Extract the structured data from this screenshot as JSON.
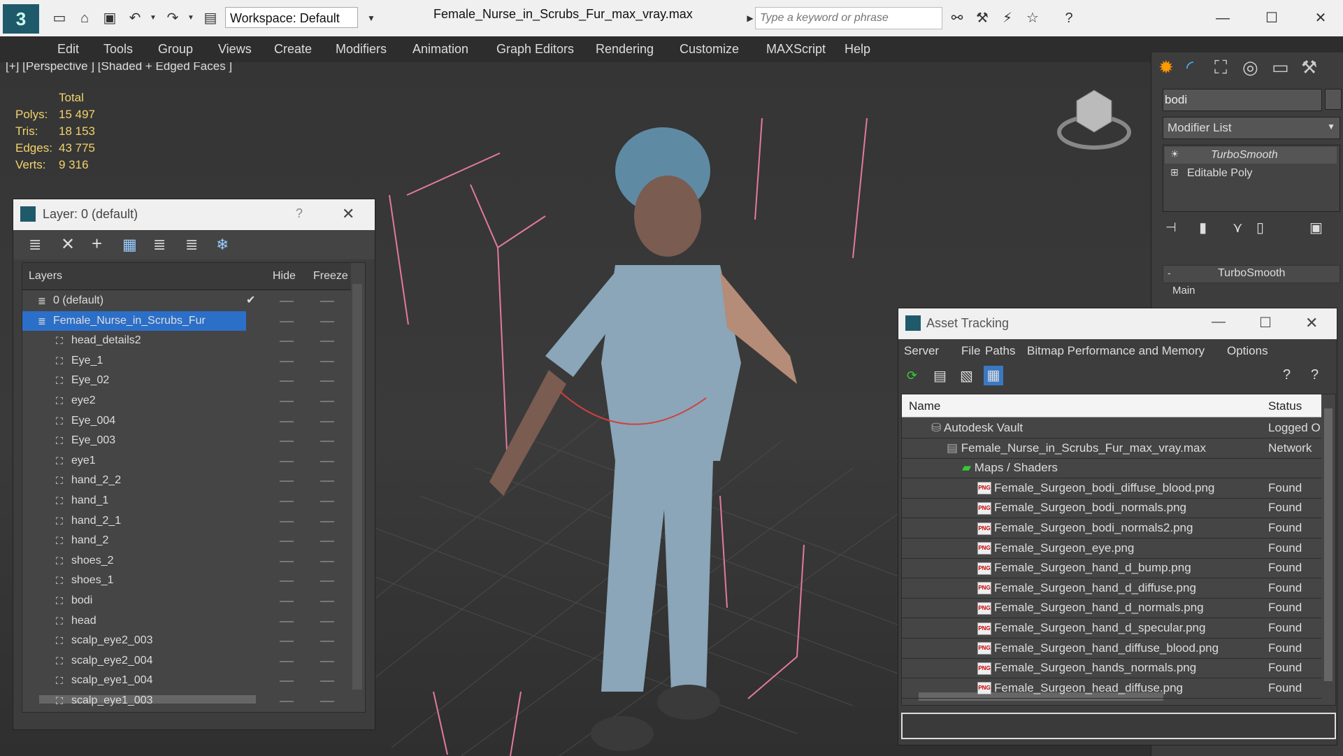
{
  "window": {
    "file_title": "Female_Nurse_in_Scrubs_Fur_max_vray.max",
    "workspace_label": "Workspace: Default",
    "search_placeholder": "Type a keyword or phrase"
  },
  "menu": [
    "Edit",
    "Tools",
    "Group",
    "Views",
    "Create",
    "Modifiers",
    "Animation",
    "Graph Editors",
    "Rendering",
    "Customize",
    "MAXScript",
    "Help"
  ],
  "viewport": {
    "label": "[+] [Perspective ] [Shaded + Edged Faces ]",
    "stats_header": "Total",
    "stats": [
      {
        "label": "Polys:",
        "value": "15 497"
      },
      {
        "label": "Tris:",
        "value": "18 153"
      },
      {
        "label": "Edges:",
        "value": "43 775"
      },
      {
        "label": "Verts:",
        "value": "9 316"
      }
    ]
  },
  "layer_panel": {
    "title": "Layer: 0 (default)",
    "help": "?",
    "col_layers": "Layers",
    "col_hide": "Hide",
    "col_freeze": "Freeze",
    "rows": [
      {
        "name": "0 (default)",
        "level": 1,
        "checked": true
      },
      {
        "name": "Female_Nurse_in_Scrubs_Fur",
        "level": 1,
        "selected": true
      },
      {
        "name": "head_details2",
        "level": 2
      },
      {
        "name": "Eye_1",
        "level": 2
      },
      {
        "name": "Eye_02",
        "level": 2
      },
      {
        "name": "eye2",
        "level": 2
      },
      {
        "name": "Eye_004",
        "level": 2
      },
      {
        "name": "Eye_003",
        "level": 2
      },
      {
        "name": "eye1",
        "level": 2
      },
      {
        "name": "hand_2_2",
        "level": 2
      },
      {
        "name": "hand_1",
        "level": 2
      },
      {
        "name": "hand_2_1",
        "level": 2
      },
      {
        "name": "hand_2",
        "level": 2
      },
      {
        "name": "shoes_2",
        "level": 2
      },
      {
        "name": "shoes_1",
        "level": 2
      },
      {
        "name": "bodi",
        "level": 2
      },
      {
        "name": "head",
        "level": 2
      },
      {
        "name": "scalp_eye2_003",
        "level": 2
      },
      {
        "name": "scalp_eye2_004",
        "level": 2
      },
      {
        "name": "scalp_eye1_004",
        "level": 2
      },
      {
        "name": "scalp_eye1_003",
        "level": 2
      }
    ]
  },
  "command_panel": {
    "object_name": "bodi",
    "modifier_list": "Modifier List",
    "stack": [
      "TurboSmooth",
      "Editable Poly"
    ],
    "rollout_title": "TurboSmooth",
    "rollout_group": "Main"
  },
  "asset_panel": {
    "title": "Asset Tracking",
    "menu": [
      "Server",
      "File",
      "Paths",
      "Bitmap Performance and Memory",
      "Options"
    ],
    "col_name": "Name",
    "col_status": "Status",
    "rows": [
      {
        "name": "Autodesk Vault",
        "status": "Logged O",
        "level": 1,
        "icon": "vault"
      },
      {
        "name": "Female_Nurse_in_Scrubs_Fur_max_vray.max",
        "status": "Network",
        "level": 2,
        "icon": "max"
      },
      {
        "name": "Maps / Shaders",
        "status": "",
        "level": 3,
        "icon": "maps"
      },
      {
        "name": "Female_Surgeon_bodi_diffuse_blood.png",
        "status": "Found",
        "level": 4,
        "icon": "png"
      },
      {
        "name": "Female_Surgeon_bodi_normals.png",
        "status": "Found",
        "level": 4,
        "icon": "png"
      },
      {
        "name": "Female_Surgeon_bodi_normals2.png",
        "status": "Found",
        "level": 4,
        "icon": "png"
      },
      {
        "name": "Female_Surgeon_eye.png",
        "status": "Found",
        "level": 4,
        "icon": "png"
      },
      {
        "name": "Female_Surgeon_hand_d_bump.png",
        "status": "Found",
        "level": 4,
        "icon": "png"
      },
      {
        "name": "Female_Surgeon_hand_d_diffuse.png",
        "status": "Found",
        "level": 4,
        "icon": "png"
      },
      {
        "name": "Female_Surgeon_hand_d_normals.png",
        "status": "Found",
        "level": 4,
        "icon": "png"
      },
      {
        "name": "Female_Surgeon_hand_d_specular.png",
        "status": "Found",
        "level": 4,
        "icon": "png"
      },
      {
        "name": "Female_Surgeon_hand_diffuse_blood.png",
        "status": "Found",
        "level": 4,
        "icon": "png"
      },
      {
        "name": "Female_Surgeon_hands_normals.png",
        "status": "Found",
        "level": 4,
        "icon": "png"
      },
      {
        "name": "Female_Surgeon_head_diffuse.png",
        "status": "Found",
        "level": 4,
        "icon": "png"
      }
    ]
  }
}
